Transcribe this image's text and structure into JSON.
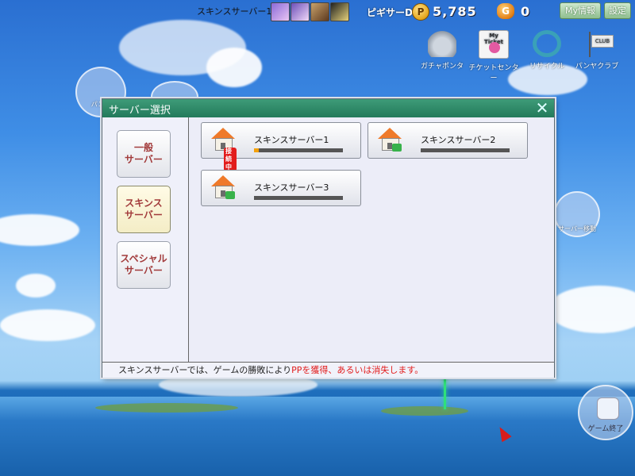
{
  "topbar": {
    "current_server": "スキンスサーバー1",
    "user_name": "ピギサーD",
    "pp_icon": "P",
    "pp_value": "5,785",
    "g_icon": "G",
    "g_value": "0",
    "my_info_label": "My情報",
    "settings_label": "設定"
  },
  "top_icons": [
    {
      "label": "ガチャポンタ",
      "icon": "gacha-icon"
    },
    {
      "label": "チケットセンター",
      "icon": "ticket-icon",
      "badge": "My Ticket"
    },
    {
      "label": "リサイクル",
      "icon": "recycle-icon"
    },
    {
      "label": "パンヤクラブ",
      "icon": "club-icon"
    }
  ],
  "side": {
    "left_button": "パンヤ",
    "server_move": "サーバー移動",
    "game_end": "ゲーム終了"
  },
  "dialog": {
    "title": "サーバー選択",
    "close_icon": "✕",
    "categories": [
      {
        "label": "一般\nサーバー",
        "active": false
      },
      {
        "label": "スキンス\nサーバー",
        "active": true
      },
      {
        "label": "スペシャル\nサーバー",
        "active": false
      }
    ],
    "servers": [
      {
        "name": "スキンスサーバー1",
        "status": "接続中",
        "load": 0.05
      },
      {
        "name": "スキンスサーバー2",
        "status": "",
        "load": 0.0
      },
      {
        "name": "スキンスサーバー3",
        "status": "",
        "load": 0.0
      }
    ],
    "footer": {
      "prefix": "スキンスサーバーでは、ゲームの勝敗により",
      "highlight": "PPを獲得、あるいは消失します。"
    }
  },
  "colors": {
    "title_bar": "#2f8c69",
    "accent_red": "#e21c1c",
    "load_bar": "#f4a10c"
  }
}
